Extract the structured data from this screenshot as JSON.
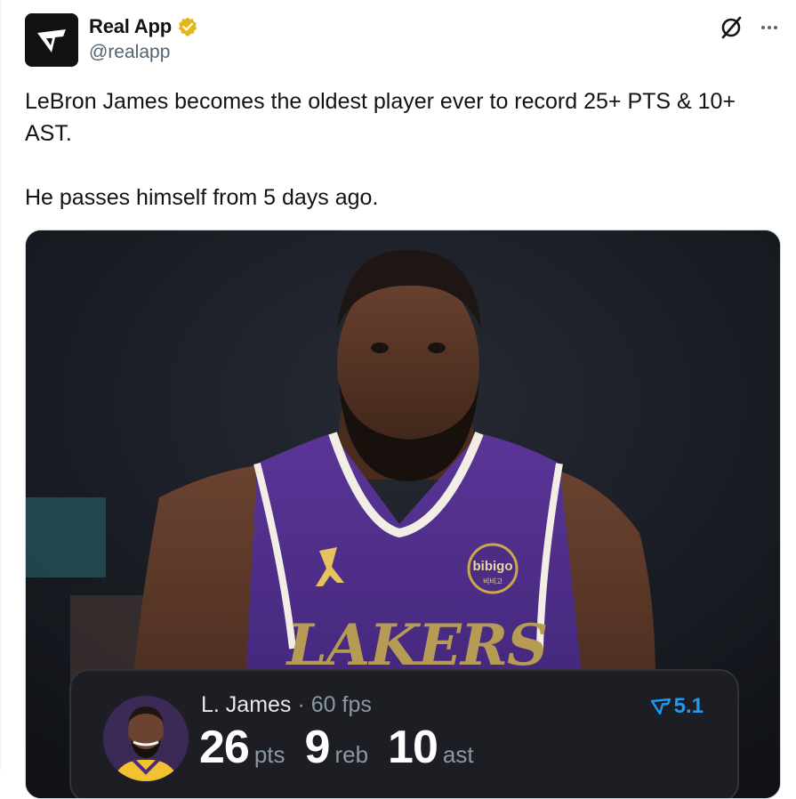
{
  "author": {
    "display_name": "Real App",
    "handle": "@realapp",
    "verified": true,
    "avatar_icon": "real-app-logo-icon",
    "verified_badge_color": "#e2b719"
  },
  "header_actions": {
    "grok_icon": "grok-icon",
    "more_icon": "more-horizontal-icon"
  },
  "tweet": {
    "text": "LeBron James becomes the oldest player ever to record 25+ PTS & 10+\nAST.\n\nHe passes himself from 5 days ago."
  },
  "media": {
    "description_icon": "photo",
    "jersey_text": "LAKERS",
    "sponsor_patch": "bibigo",
    "sponsor_patch_sub": "비비고",
    "stat_card": {
      "player_name": "L. James",
      "separator": "·",
      "fps": "60 fps",
      "rating": "5.1",
      "rating_icon": "real-app-logo-icon",
      "stats": [
        {
          "value": "26",
          "unit": "pts"
        },
        {
          "value": "9",
          "unit": "reb"
        },
        {
          "value": "10",
          "unit": "ast"
        }
      ]
    }
  },
  "colors": {
    "text_primary": "#0f1419",
    "text_secondary": "#536471",
    "accent_blue": "#1d9bf0",
    "lakers_purple": "#4b2d83",
    "lakers_gold": "#c9a94a"
  }
}
